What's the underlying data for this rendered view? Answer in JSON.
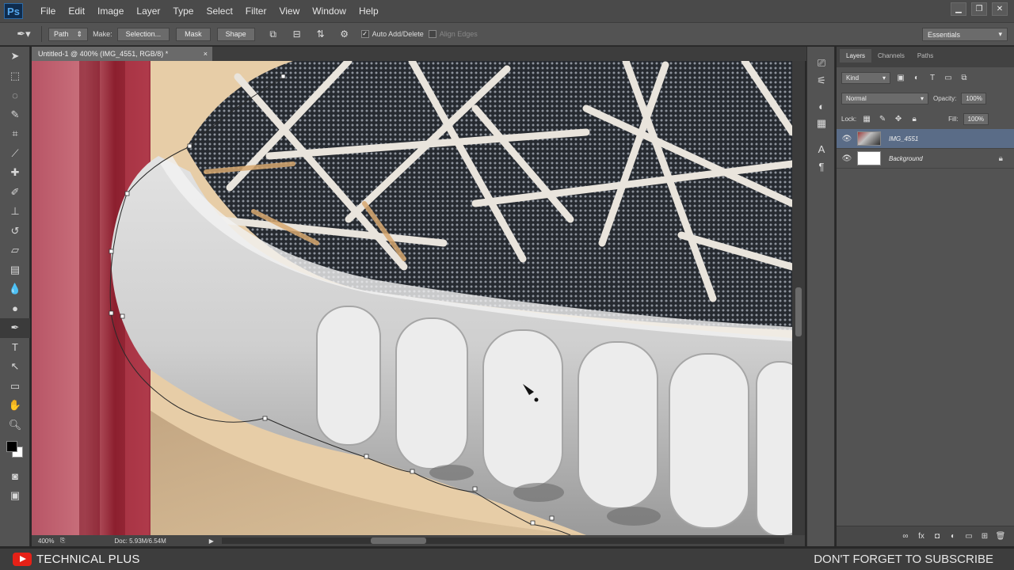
{
  "app": {
    "logo": "Ps"
  },
  "menu": [
    "File",
    "Edit",
    "Image",
    "Layer",
    "Type",
    "Select",
    "Filter",
    "View",
    "Window",
    "Help"
  ],
  "window_controls": [
    "minimize-icon",
    "restore-icon",
    "close-icon"
  ],
  "options_bar": {
    "tool_mode": "Path",
    "make_label": "Make:",
    "selection_btn": "Selection...",
    "mask_btn": "Mask",
    "shape_btn": "Shape",
    "auto_add_delete": "Auto Add/Delete",
    "align_edges": "Align Edges",
    "workspace": "Essentials"
  },
  "document": {
    "tab_title": "Untitled-1 @ 400% (IMG_4551, RGB/8) *",
    "zoom": "400%",
    "doc_size": "Doc: 5.93M/6.54M"
  },
  "layers_panel": {
    "tabs": [
      "Layers",
      "Channels",
      "Paths"
    ],
    "filter": "Kind",
    "blend_mode": "Normal",
    "opacity_label": "Opacity:",
    "opacity": "100%",
    "lock_label": "Lock:",
    "fill_label": "Fill:",
    "fill": "100%",
    "layers": [
      {
        "name": "IMG_4551",
        "selected": true
      },
      {
        "name": "Background",
        "locked": true
      }
    ]
  },
  "banner": {
    "channel": "TECHNICAL PLUS",
    "cta": "DON'T FORGET TO SUBSCRIBE"
  },
  "colors": {
    "accent_selected_layer": "#5a6c87",
    "youtube_red": "#e62117"
  }
}
